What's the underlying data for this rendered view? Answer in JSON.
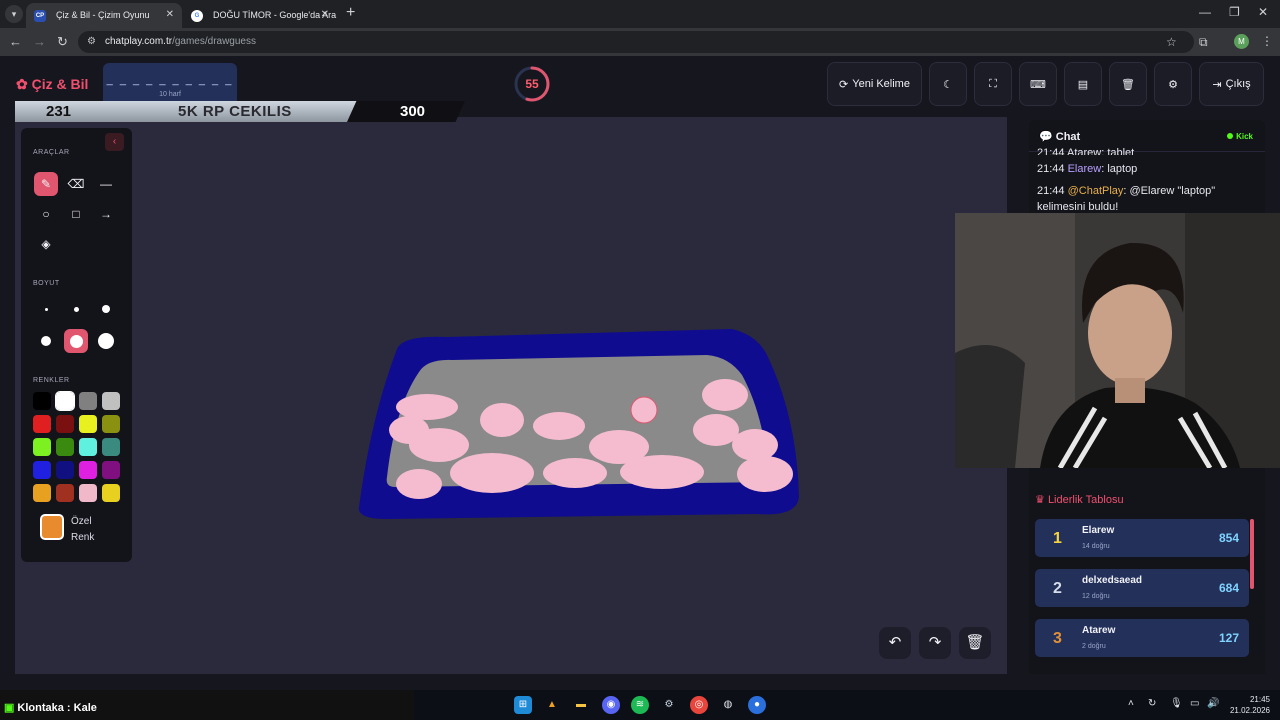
{
  "browser": {
    "tabs": [
      {
        "favicon": "CP",
        "title": "Çiz & Bil - Çizim Oyunu"
      },
      {
        "favicon": "G",
        "title": "DOĞU TİMOR - Google'da Ara"
      }
    ],
    "url_domain": "chatplay.com.tr",
    "url_path": "/games/drawguess",
    "profile_initial": "M"
  },
  "app": {
    "logo": "Çiz & Bil",
    "word_blanks": "_ _ _ _ _ _ _ _ _ _",
    "word_hint": "10 harf",
    "timer": "55",
    "timer_fraction": 0.55,
    "buttons": {
      "new_word": "Yeni Kelime",
      "exit": "Çıkış"
    }
  },
  "banner": {
    "left": "231",
    "middle": "5K RP CEKILIS",
    "right": "300"
  },
  "tools": {
    "title": "ARAÇLAR",
    "size_title": "BOYUT",
    "colors_title": "RENKLER",
    "custom_line1": "Özel",
    "custom_line2": "Renk",
    "custom_color": "#e88a2e",
    "colors": [
      "#000000",
      "#ffffff",
      "#808080",
      "#c0c0c0",
      "#e02020",
      "#7a1010",
      "#e8f020",
      "#8a9010",
      "#7cf020",
      "#3a8a10",
      "#60f0e0",
      "#3a8a80",
      "#2020e0",
      "#101080",
      "#e020e0",
      "#801080",
      "#e8a020",
      "#a03020",
      "#f0b8c8",
      "#e8d020"
    ]
  },
  "chat": {
    "title": "Chat",
    "platform": "Kick",
    "partial_line": "21:44 Atarew: tablet",
    "messages": [
      {
        "time": "21:44",
        "user": "Elarew",
        "text": ": laptop"
      },
      {
        "time": "21:44",
        "user": "@ChatPlay",
        "text": ": @Elarew \"laptop\" kelimesini buldu!"
      }
    ]
  },
  "leaderboard": {
    "title": "Liderlik Tablosu",
    "rows": [
      {
        "rank": "1",
        "name": "Elarew",
        "sub": "14 doğru",
        "points": "854",
        "rank_color": "#f5d442"
      },
      {
        "rank": "2",
        "name": "delxedsaead",
        "sub": "12 doğru",
        "points": "684",
        "rank_color": "#d6dce8"
      },
      {
        "rank": "3",
        "name": "Atarew",
        "sub": "2 doğru",
        "points": "127",
        "rank_color": "#e0913a"
      }
    ]
  },
  "taskbar": {
    "overlay_user": "Klontaka",
    "overlay_text": " : Kale",
    "time": "21:45",
    "date": "21.02.2026"
  }
}
